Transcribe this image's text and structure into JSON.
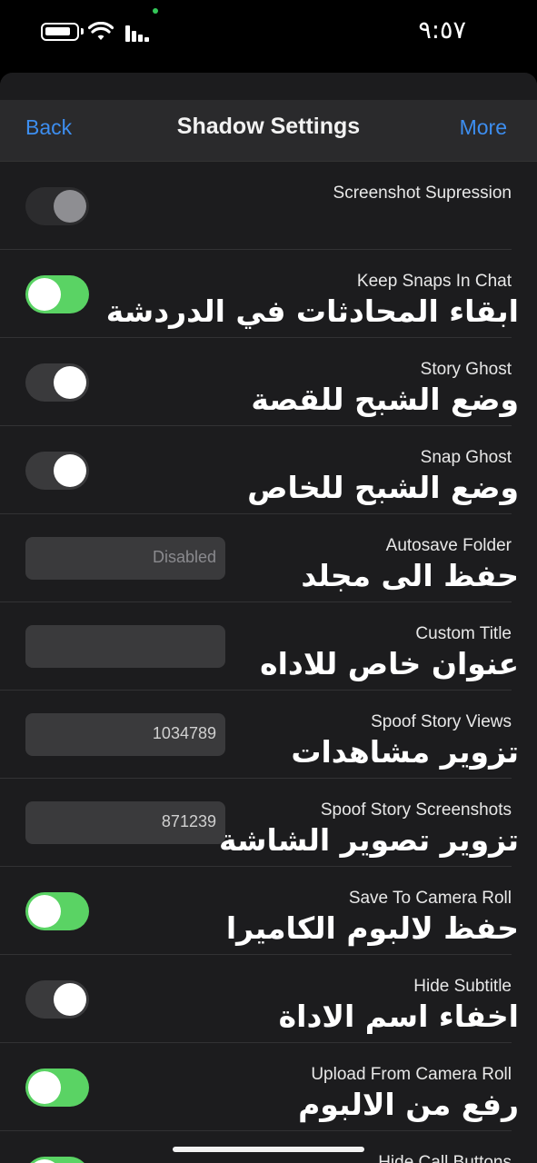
{
  "status_bar": {
    "time": "٩:٥٧"
  },
  "navbar": {
    "back_label": "Back",
    "title": "Shadow Settings",
    "more_label": "More"
  },
  "colors": {
    "accent": "#3d8ef0",
    "toggle_on": "#5ad364",
    "background": "#1c1c1e"
  },
  "settings": [
    {
      "title": "Screenshot Supression",
      "overlay": "",
      "control": "toggle",
      "state": "off-disabled"
    },
    {
      "title": "Keep Snaps In Chat",
      "overlay": "ابقاء المحادثات في الدردشة",
      "control": "toggle",
      "state": "on"
    },
    {
      "title": "Story Ghost",
      "overlay": "وضع الشبح للقصة",
      "control": "toggle",
      "state": "off"
    },
    {
      "title": "Snap Ghost",
      "overlay": "وضع الشبح للخاص",
      "control": "toggle",
      "state": "off"
    },
    {
      "title": "Autosave Folder",
      "overlay": "حفظ الى مجلد",
      "control": "text-field",
      "value": "",
      "placeholder": "Disabled"
    },
    {
      "title": "Custom Title",
      "overlay": "عنوان خاص للاداه",
      "control": "text-field",
      "value": "",
      "placeholder": ""
    },
    {
      "title": "Spoof Story Views",
      "overlay": "تزوير مشاهدات",
      "control": "text-field",
      "value": "1034789"
    },
    {
      "title": "Spoof Story Screenshots",
      "overlay": "تزوير تصوير الشاشة",
      "control": "text-field",
      "value": "871239"
    },
    {
      "title": "Save To Camera Roll",
      "overlay": "حفظ لالبوم الكاميرا",
      "control": "toggle",
      "state": "on"
    },
    {
      "title": "Hide Subtitle",
      "overlay": "اخفاء اسم الاداة",
      "control": "toggle",
      "state": "off"
    },
    {
      "title": "Upload From Camera Roll",
      "overlay": "رفع من الالبوم",
      "control": "toggle",
      "state": "on"
    },
    {
      "title": "Hide Call Buttons",
      "overlay": "",
      "control": "toggle",
      "state": "on"
    }
  ]
}
